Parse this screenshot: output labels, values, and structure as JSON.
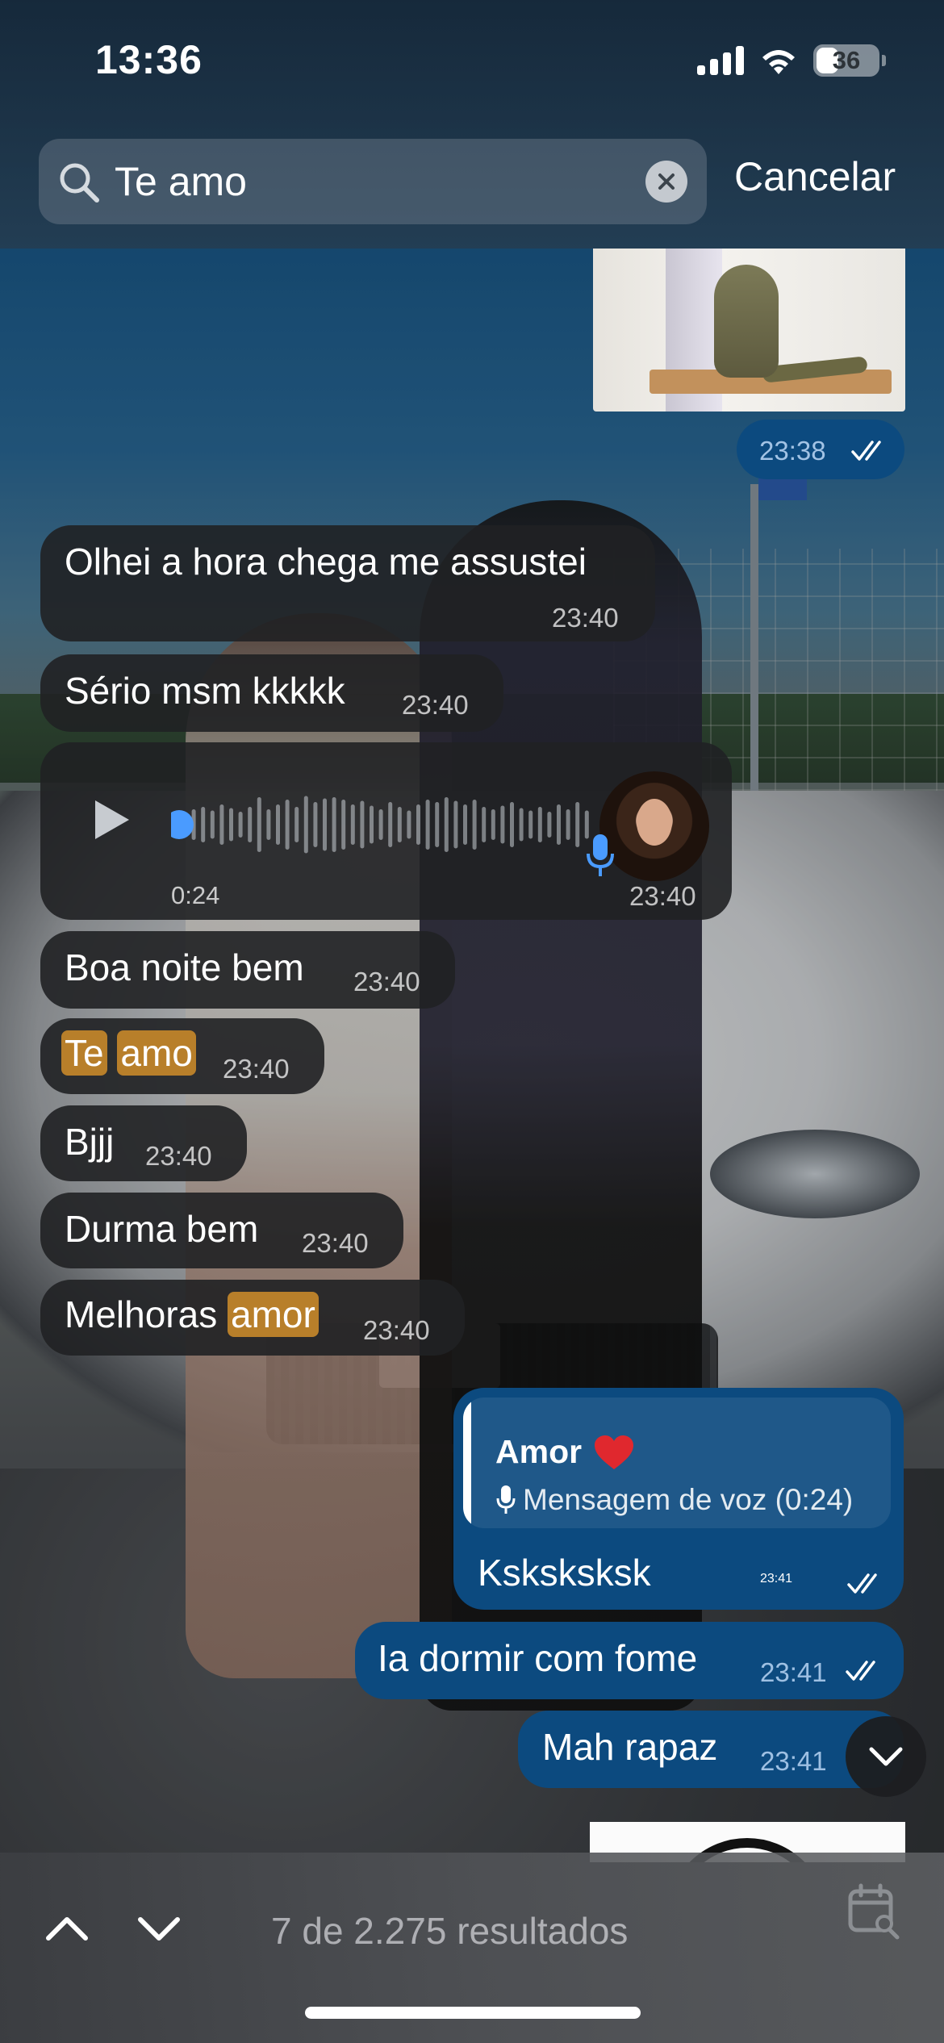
{
  "status_bar": {
    "time": "13:36",
    "battery_level": "36",
    "battery_fraction": 0.36
  },
  "search": {
    "query": "Te amo",
    "cancel_label": "Cancelar"
  },
  "messages": {
    "photo_time": "23:38",
    "msg1": {
      "text": "Olhei a hora chega me assustei",
      "time": "23:40"
    },
    "msg2": {
      "text": "Sério msm kkkkk",
      "time": "23:40"
    },
    "voice": {
      "duration": "0:24",
      "time": "23:40",
      "progress": 0.0
    },
    "msg3": {
      "text": "Boa noite bem",
      "time": "23:40"
    },
    "msg4": {
      "word1": "Te",
      "word2": "amo",
      "time": "23:40"
    },
    "msg5": {
      "text": "Bjjj",
      "time": "23:40"
    },
    "msg6": {
      "text": "Durma bem",
      "time": "23:40"
    },
    "msg7": {
      "text": "Melhoras",
      "highlight": "amor",
      "time": "23:40"
    },
    "reply": {
      "quoted_name": "Amor",
      "quoted_text": "Mensagem de voz (0:24)",
      "text": "Ksksksksk",
      "time": "23:41"
    },
    "msg8": {
      "text": "Ia dormir com fome",
      "time": "23:41"
    },
    "msg9": {
      "text": "Mah rapaz",
      "time": "23:41"
    }
  },
  "bottom_bar": {
    "results": "7 de 2.275 resultados"
  },
  "colors": {
    "incoming_bubble": "#202124",
    "outgoing_bubble": "#0c4a7f",
    "search_highlight": "#b87f2a",
    "voice_accent": "#4a9bff"
  },
  "icons": [
    "search-icon",
    "clear-icon",
    "read-ticks-icon",
    "play-icon",
    "microphone-icon",
    "heart-icon",
    "chevron-down-icon",
    "chevron-up-icon",
    "calendar-search-icon"
  ]
}
